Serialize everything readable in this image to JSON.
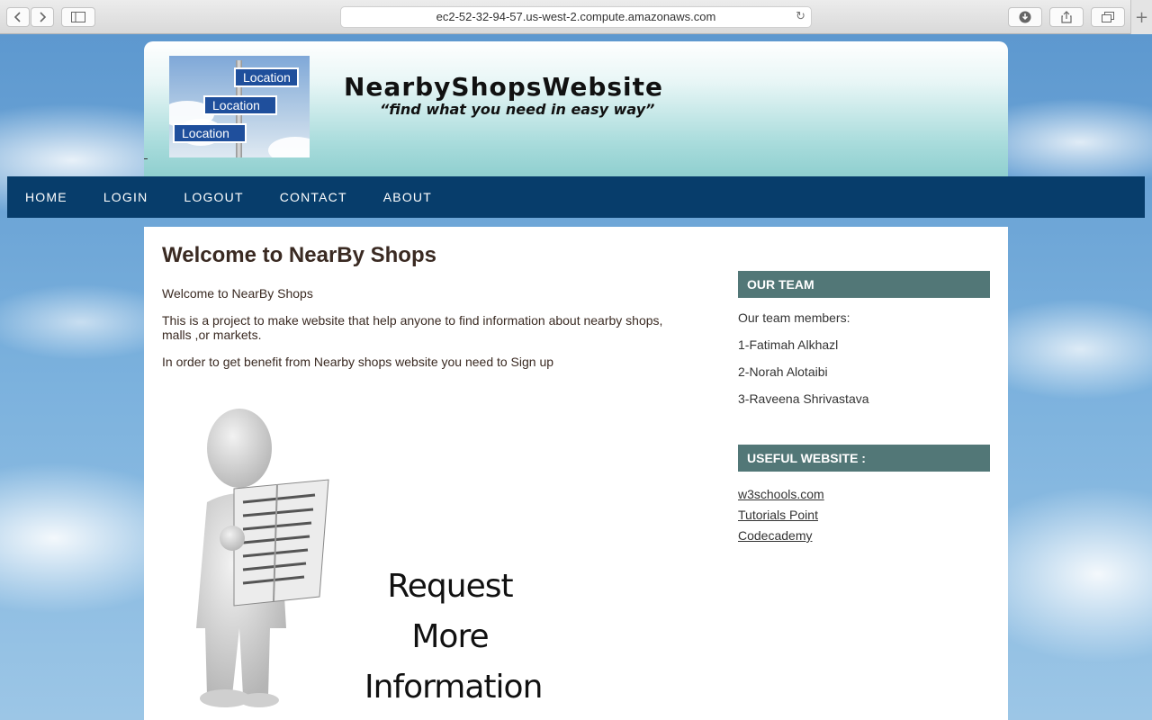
{
  "browser": {
    "url": "ec2-52-32-94-57.us-west-2.compute.amazonaws.com",
    "back_icon": "chevron-left-icon",
    "forward_icon": "chevron-right-icon",
    "sidebar_icon": "sidebar-icon",
    "reload_icon": "reload-icon",
    "download_icon": "download-icon",
    "share_icon": "share-icon",
    "tabs_icon": "tabs-icon",
    "new_tab_icon": "plus-icon"
  },
  "header": {
    "logo_signs": [
      "Location",
      "Location",
      "Location"
    ],
    "site_title": "NearbyShopsWebsite",
    "tagline": "“find what you need in easy way”"
  },
  "nav": {
    "items": [
      "HOME",
      "LOGIN",
      "LOGOUT",
      "CONTACT",
      "ABOUT"
    ]
  },
  "main": {
    "heading": "Welcome to NearBy Shops",
    "paragraphs": [
      "Welcome to NearBy Shops",
      "This is a project to make website that help anyone to find information about nearby shops, malls ,or markets.",
      "In order to get benefit from Nearby shops website you need to Sign up"
    ],
    "illustration_lines": [
      "Request",
      "More",
      "Information"
    ]
  },
  "sidebar": {
    "team_heading": "OUR TEAM",
    "team_intro": "Our team members:",
    "members": [
      "1-Fatimah Alkhazl",
      "2-Norah Alotaibi",
      "3-Raveena Shrivastava"
    ],
    "links_heading": "USEFUL WEBSITE :",
    "links": [
      "w3schools.com",
      "Tutorials Point",
      "Codecademy"
    ]
  },
  "colors": {
    "nav_bg": "#073d6b",
    "sidebar_heading_bg": "#527777",
    "text": "#3a2a22"
  }
}
